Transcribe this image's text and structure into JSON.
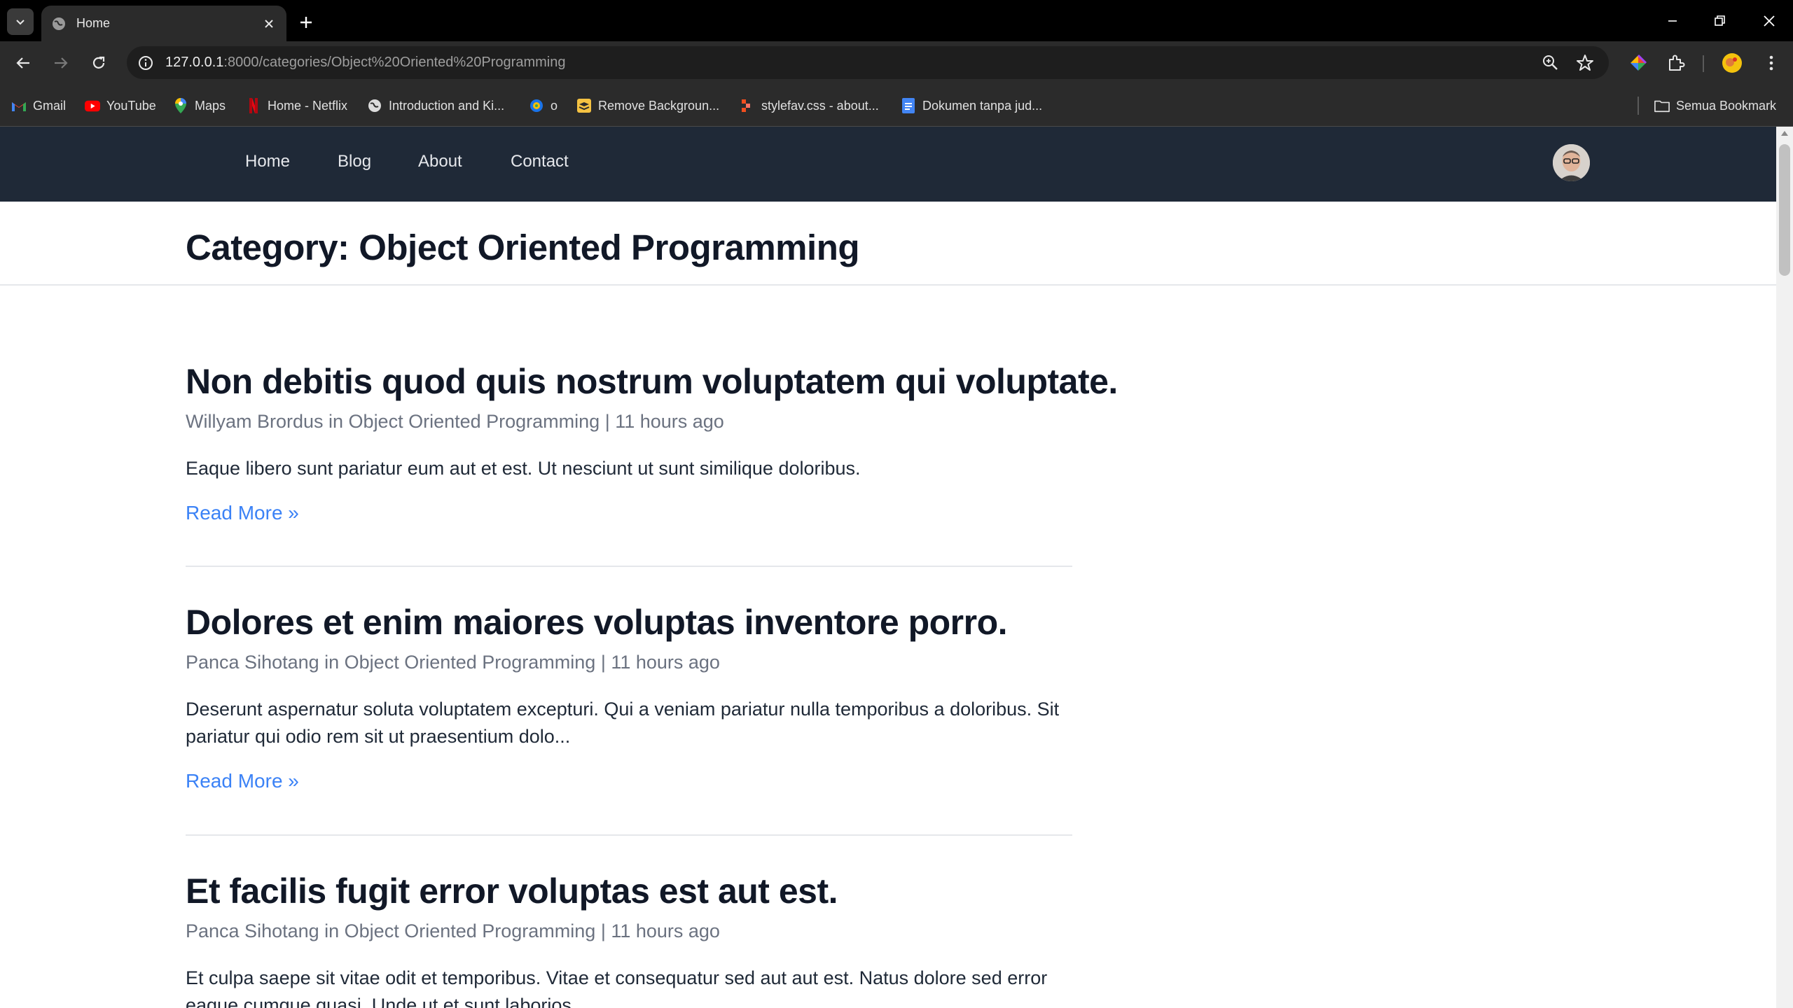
{
  "browser": {
    "tab_title": "Home",
    "url_host": "127.0.0.1",
    "url_rest": ":8000/categories/Object%20Oriented%20Programming",
    "bookmarks": [
      {
        "label": "Gmail",
        "icon": "gmail-icon"
      },
      {
        "label": "YouTube",
        "icon": "youtube-icon"
      },
      {
        "label": "Maps",
        "icon": "maps-icon"
      },
      {
        "label": "Home - Netflix",
        "icon": "netflix-icon"
      },
      {
        "label": "Introduction and Ki...",
        "icon": "globe-icon"
      },
      {
        "label": "o",
        "icon": "extension-site-icon"
      },
      {
        "label": "Remove Backgroun...",
        "icon": "removebg-icon"
      },
      {
        "label": "stylefav.css - about...",
        "icon": "figma-like-icon"
      },
      {
        "label": "Dokumen tanpa jud...",
        "icon": "docs-icon"
      }
    ],
    "all_bookmarks_label": "Semua Bookmark",
    "colors": {
      "chrome_dark": "#2b2b2b",
      "tabbar": "#000000",
      "nav_bg": "#1f2937",
      "link_blue": "#3b82f6"
    }
  },
  "site": {
    "nav": [
      "Home",
      "Blog",
      "About",
      "Contact"
    ],
    "page_title": "Category: Object Oriented Programming",
    "posts": [
      {
        "title": "Non debitis quod quis nostrum voluptatem qui voluptate.",
        "meta": "Willyam Brordus in Object Oriented Programming | 11 hours ago",
        "excerpt": "Eaque libero sunt pariatur eum aut et est. Ut nesciunt ut sunt similique doloribus.",
        "read_more": "Read More »"
      },
      {
        "title": "Dolores et enim maiores voluptas inventore porro.",
        "meta": "Panca Sihotang in Object Oriented Programming | 11 hours ago",
        "excerpt": "Deserunt aspernatur soluta voluptatem excepturi. Qui a veniam pariatur nulla temporibus a doloribus. Sit pariatur qui odio rem sit ut praesentium dolo...",
        "read_more": "Read More »"
      },
      {
        "title": "Et facilis fugit error voluptas est aut est.",
        "meta": "Panca Sihotang in Object Oriented Programming | 11 hours ago",
        "excerpt": "Et culpa saepe sit vitae odit et temporibus. Vitae et consequatur sed aut aut est. Natus dolore sed error eaque cumque quasi. Unde ut et sunt laborios..."
      }
    ]
  }
}
